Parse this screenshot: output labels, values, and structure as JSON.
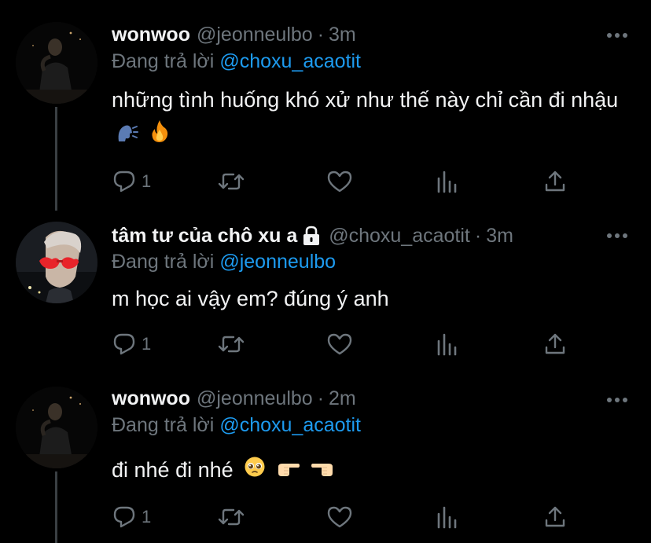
{
  "colors": {
    "background": "#000000",
    "text": "#f2f3f4",
    "muted": "#6e767d",
    "link": "#1d9bf0",
    "thread_line": "#3a3f43"
  },
  "tweets": [
    {
      "name": "wonwoo",
      "handle": "@jeonneulbo",
      "dot": "·",
      "time": "3m",
      "protected": false,
      "reply_prefix": "Đang trả lời",
      "reply_to": "@choxu_acaotit",
      "text": "những tình huống khó xử như thế này chỉ cần đi nhậu",
      "emojis": [
        "speaking-head-emoji",
        "fire-emoji"
      ],
      "reply_count": "1",
      "icons": [
        "reply-icon",
        "retweet-icon",
        "like-icon",
        "analytics-icon",
        "share-icon",
        "more-icon"
      ]
    },
    {
      "name": "tâm tư của chô xu a",
      "handle": "@choxu_acaotit",
      "dot": "·",
      "time": "3m",
      "protected": true,
      "reply_prefix": "Đang trả lời",
      "reply_to": "@jeonneulbo",
      "text": "m học ai vậy em? đúng ý anh",
      "emojis": [],
      "reply_count": "1",
      "icons": [
        "reply-icon",
        "retweet-icon",
        "like-icon",
        "analytics-icon",
        "share-icon",
        "more-icon"
      ]
    },
    {
      "name": "wonwoo",
      "handle": "@jeonneulbo",
      "dot": "·",
      "time": "2m",
      "protected": false,
      "reply_prefix": "Đang trả lời",
      "reply_to": "@choxu_acaotit",
      "text": "đi nhé đi nhé",
      "emojis": [
        "pleading-face-emoji",
        "pointing-right-emoji",
        "pointing-left-emoji"
      ],
      "reply_count": "1",
      "icons": [
        "reply-icon",
        "retweet-icon",
        "like-icon",
        "analytics-icon",
        "share-icon",
        "more-icon"
      ]
    }
  ]
}
